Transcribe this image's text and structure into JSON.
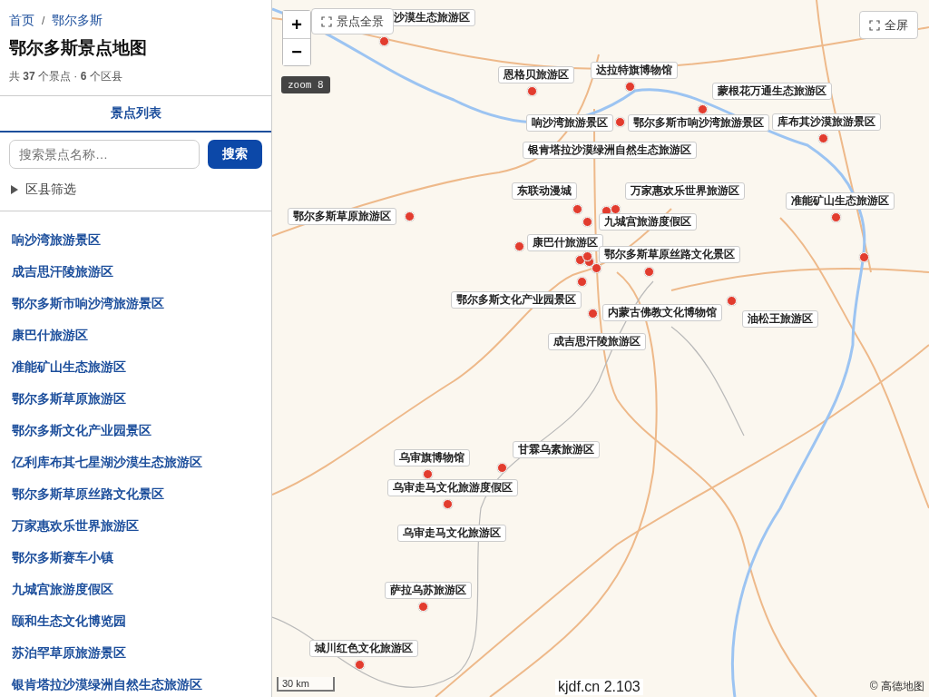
{
  "sidebar": {
    "breadcrumb": [
      {
        "label": "首页"
      },
      {
        "label": "鄂尔多斯"
      }
    ],
    "breadcrumb_separator": "/",
    "title": "鄂尔多斯景点地图",
    "stats": "共 **37** 个景点 · **6** 个区县",
    "tabs": [
      {
        "label": "景点列表",
        "selected": true
      }
    ],
    "search": {
      "placeholder": "搜索景点名称…",
      "button": "搜索"
    },
    "filter": {
      "label": "区县筛选",
      "expanded": false
    },
    "items": [
      "响沙湾旅游景区",
      "成吉思汗陵旅游区",
      "鄂尔多斯市响沙湾旅游景区",
      "康巴什旅游区",
      "准能矿山生态旅游区",
      "鄂尔多斯草原旅游区",
      "鄂尔多斯文化产业园景区",
      "亿利库布其七星湖沙漠生态旅游区",
      "鄂尔多斯草原丝路文化景区",
      "万家惠欢乐世界旅游区",
      "鄂尔多斯赛车小镇",
      "九城宫旅游度假区",
      "颐和生态文化博览园",
      "苏泊罕草原旅游景区",
      "银肯塔拉沙漠绿洲自然生态旅游区"
    ]
  },
  "map": {
    "zoom_in": "+",
    "zoom_out": "−",
    "overview_button": "景点全景",
    "fullscreen_button": "全屏",
    "zoom_badge": "zoom 8",
    "labels": [
      "沙漠生态旅游区",
      "恩格贝旅游区",
      "达拉特旗博物馆",
      "蒙根花万通生态旅游区",
      "响沙湾旅游景区",
      "鄂尔多斯市响沙湾旅游景区",
      "库布其沙漠旅游景区",
      "银肯塔拉沙漠绿洲自然生态旅游区",
      "东联动漫城",
      "万家惠欢乐世界旅游区",
      "准能矿山生态旅游区",
      "鄂尔多斯草原旅游区",
      "九城宫旅游度假区",
      "康巴什旅游区",
      "鄂尔多斯草原丝路文化景区",
      "鄂尔多斯文化产业园景区",
      "内蒙古佛教文化博物馆",
      "油松王旅游区",
      "成吉思汗陵旅游区",
      "甘霖乌素旅游区",
      "乌审旗博物馆",
      "乌审走马文化旅游度假区",
      "乌审走马文化旅游区",
      "萨拉乌苏旅游区",
      "城川红色文化旅游区"
    ],
    "scale": "30 km",
    "version": "kjdf.cn 2.103",
    "attribution": "© 高德地图"
  }
}
